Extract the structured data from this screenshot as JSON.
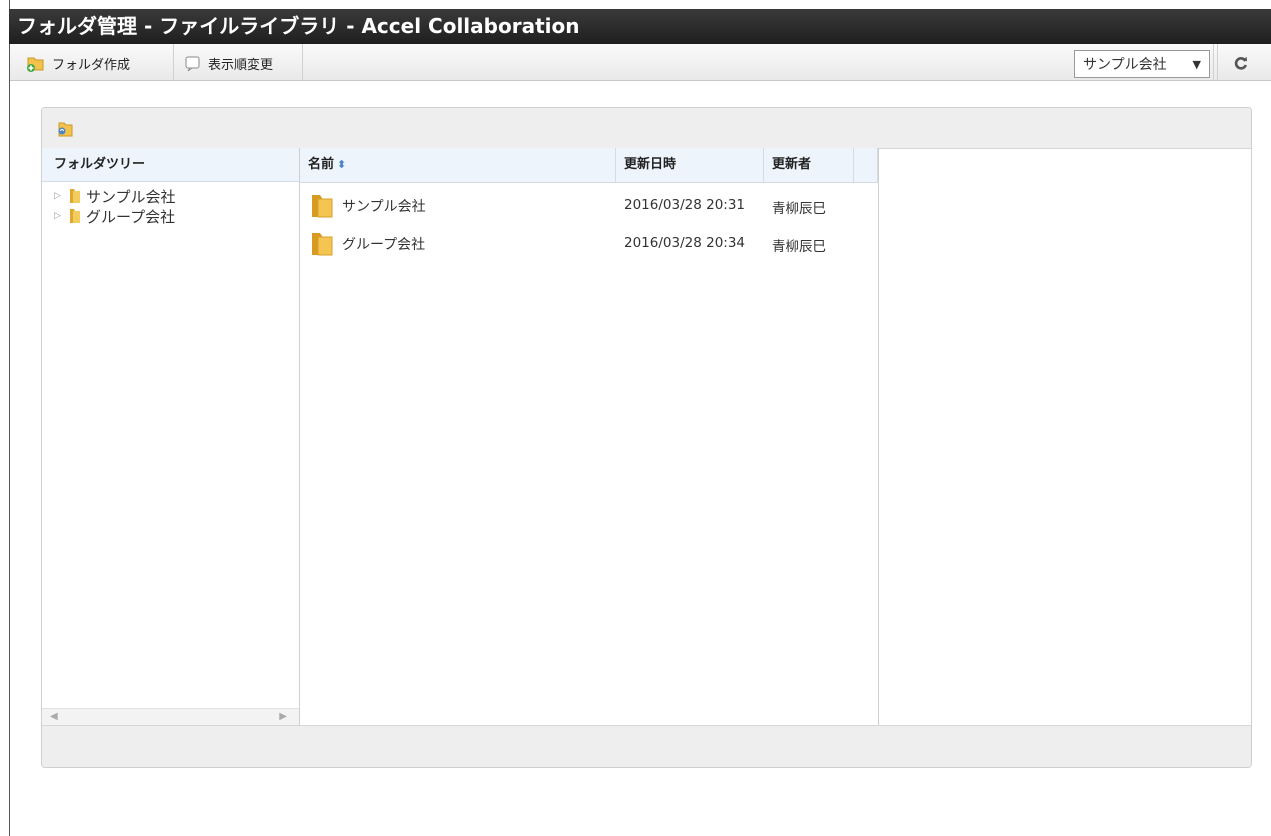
{
  "window": {
    "title": "フォルダ管理 - ファイルライブラリ - Accel Collaboration"
  },
  "toolbar": {
    "create_folder_label": "フォルダ作成",
    "change_order_label": "表示順変更",
    "company_select_value": "サンプル会社",
    "refresh_icon": "refresh-icon"
  },
  "tree": {
    "header": "フォルダツリー",
    "items": [
      {
        "label": "サンプル会社"
      },
      {
        "label": "グループ会社"
      }
    ]
  },
  "list": {
    "columns": {
      "name": "名前",
      "updated_at": "更新日時",
      "updated_by": "更新者"
    },
    "rows": [
      {
        "name": "サンプル会社",
        "updated_at": "2016/03/28 20:31",
        "updated_by": "青柳辰巳"
      },
      {
        "name": "グループ会社",
        "updated_at": "2016/03/28 20:34",
        "updated_by": "青柳辰巳"
      }
    ]
  },
  "colors": {
    "titlebar": "#2b2b2b",
    "header_bg": "#eef4fb",
    "folder": "#f2c24d"
  }
}
